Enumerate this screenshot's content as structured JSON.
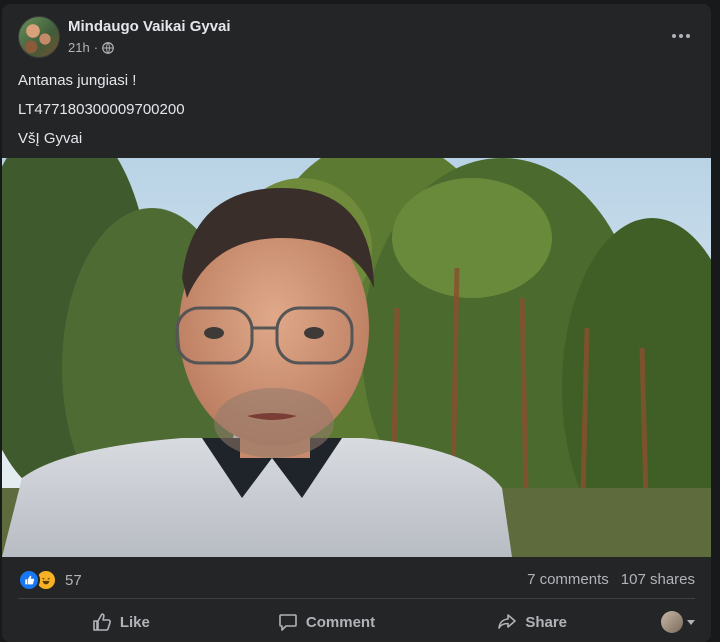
{
  "post": {
    "author": "Mindaugo Vaikai Gyvai",
    "time": "21h",
    "privacy_icon": "globe-icon",
    "lines": [
      "Antanas jungiasi !",
      "LT477180300009700200",
      "VšĮ  Gyvai"
    ]
  },
  "stats": {
    "reaction_icons": [
      "like-reaction-icon",
      "haha-reaction-icon"
    ],
    "reaction_count": "57",
    "comments": "7 comments",
    "shares": "107 shares"
  },
  "actions": {
    "like": "Like",
    "comment": "Comment",
    "share": "Share"
  },
  "colors": {
    "background": "#18191a",
    "card": "#242526",
    "accent": "#1877f2",
    "text_secondary": "#b0b3b8"
  }
}
